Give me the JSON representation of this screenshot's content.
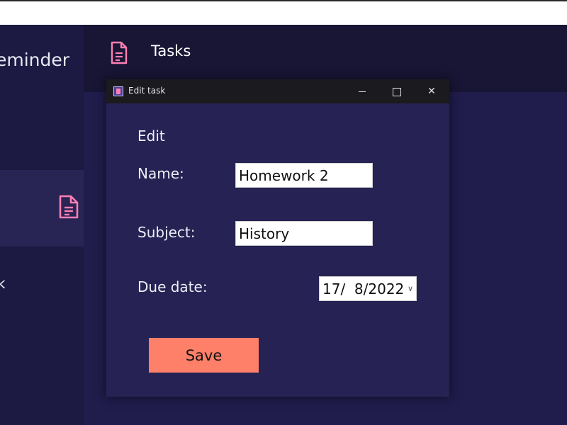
{
  "app": {
    "title": "eminder",
    "side_item_text": "k"
  },
  "header": {
    "title": "Tasks"
  },
  "dialog": {
    "window_title": "Edit task",
    "heading": "Edit",
    "name_label": "Name:",
    "name_value": "Homework 2",
    "subject_label": "Subject:",
    "subject_value": "History",
    "due_label": "Due date:",
    "due_value": "17/  8/2022",
    "save_label": "Save",
    "close_glyph": "✕"
  },
  "colors": {
    "accent_pink": "#ff7fb2",
    "save_button": "#ff8069",
    "background": "#201c4b"
  }
}
